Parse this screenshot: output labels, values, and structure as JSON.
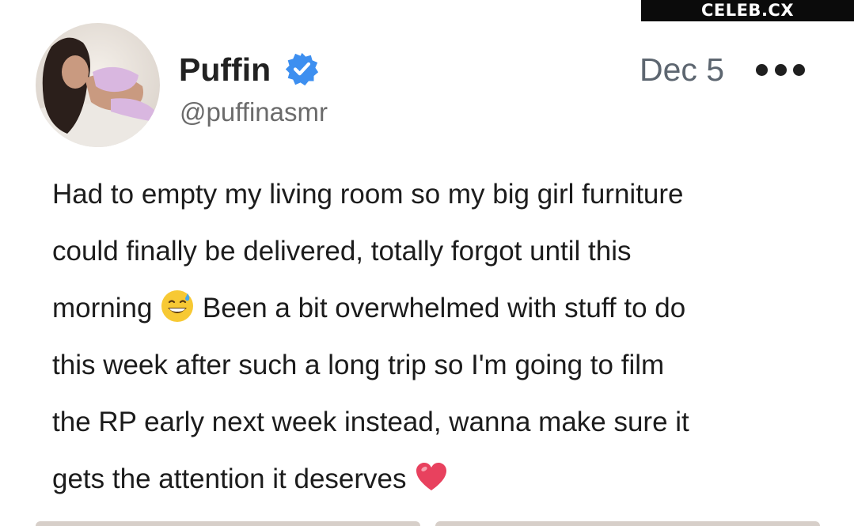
{
  "watermark": {
    "text": "CELEB.CX"
  },
  "post": {
    "display_name": "Puffin",
    "handle": "@puffinasmr",
    "date": "Dec 5",
    "verified": true,
    "avatar_icon": "profile-photo",
    "more_icon": "more-options-icon",
    "body": {
      "line1": "Had to empty my living room so my big girl furniture",
      "line2": "could finally be delivered, totally forgot until this",
      "line3a": "morning",
      "emoji1": "grinning-face-with-sweat-emoji",
      "line3b": "Been a bit overwhelmed with stuff to do",
      "line4": "this week after such a long trip so I'm going to film",
      "line5": "the RP early next week instead, wanna make sure it",
      "line6": "gets the attention it deserves",
      "emoji2": "red-heart-emoji"
    }
  },
  "colors": {
    "verified": "#3d8ff0",
    "heart": "#e8415e",
    "date": "#5d6670",
    "handle": "#6b6b6b"
  }
}
